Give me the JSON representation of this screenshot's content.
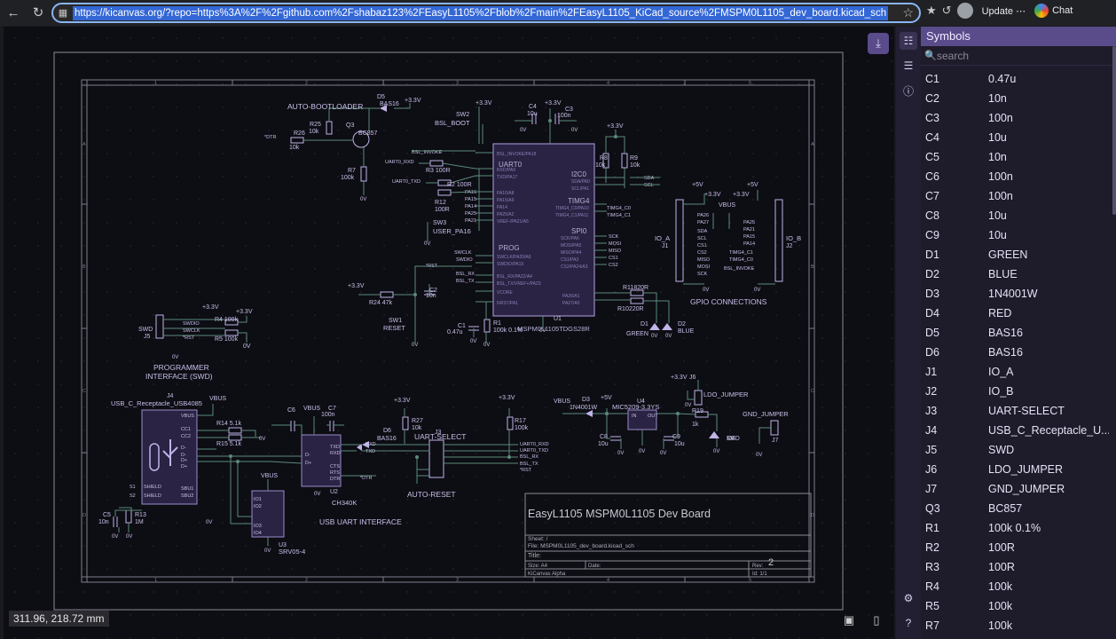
{
  "browser": {
    "url": "https://kicanvas.org/?repo=https%3A%2F%2Fgithub.com%2Fshabaz123%2FEasyL1105%2Fblob%2Fmain%2FEasyL1105_KiCad_source%2FMSPM0L1105_dev_board.kicad_sch",
    "update_label": "Update",
    "chat_label": "Chat"
  },
  "viewer": {
    "coordinates": "311.96, 218.72 mm"
  },
  "schematic": {
    "title": "EasyL1105 MSPM0L1105 Dev Board",
    "sheet_line": "Sheet: /",
    "file_line": "File: MSPM0L1105_dev_board.kicad_sch",
    "title_label": "Title:",
    "size_label": "Size: A4",
    "date_label": "Date:",
    "rev_label": "Rev:",
    "rev_value": "2",
    "tool_label": "KiCanvas Alpha",
    "id_label": "Id: 1/1",
    "labels": {
      "auto_bootloader": "AUTO-BOOTLOADER",
      "programmer": "PROGRAMMER",
      "interface_swd": "INTERFACE (SWD)",
      "usb_uart": "USB UART INTERFACE",
      "uart_select": "UART-SELECT",
      "auto_reset": "AUTO-RESET",
      "gpio_connections": "GPIO CONNECTIONS",
      "ldo_jumper": "LDO_JUMPER",
      "gnd_jumper": "GND_JUMPER",
      "usb_c": "USB_C_Receptacle_USB4085",
      "mcu": "MSPM0L1105TDGS28R",
      "ldo": "MIC5209-3.3YS",
      "ch340": "CH340K",
      "srv": "SRV05-4",
      "user_pa16": "USER_PA16",
      "reset": "RESET",
      "bsl_boot": "BSL_BOOT",
      "plus33": "+3.3V",
      "vbus": "VBUS",
      "plus5": "+5V",
      "uart0": "UART0",
      "i2c0": "I2C0",
      "timg4": "TIMG4",
      "spi0": "SPI0",
      "prog": "PROG",
      "io_a": "IO_A",
      "io_b": "IO_B"
    }
  },
  "panel": {
    "title": "Symbols",
    "search_placeholder": "search",
    "symbols": [
      {
        "ref": "C1",
        "value": "0.47u"
      },
      {
        "ref": "C2",
        "value": "10n"
      },
      {
        "ref": "C3",
        "value": "100n"
      },
      {
        "ref": "C4",
        "value": "10u"
      },
      {
        "ref": "C5",
        "value": "10n"
      },
      {
        "ref": "C6",
        "value": "100n"
      },
      {
        "ref": "C7",
        "value": "100n"
      },
      {
        "ref": "C8",
        "value": "10u"
      },
      {
        "ref": "C9",
        "value": "10u"
      },
      {
        "ref": "D1",
        "value": "GREEN"
      },
      {
        "ref": "D2",
        "value": "BLUE"
      },
      {
        "ref": "D3",
        "value": "1N4001W"
      },
      {
        "ref": "D4",
        "value": "RED"
      },
      {
        "ref": "D5",
        "value": "BAS16"
      },
      {
        "ref": "D6",
        "value": "BAS16"
      },
      {
        "ref": "J1",
        "value": "IO_A"
      },
      {
        "ref": "J2",
        "value": "IO_B"
      },
      {
        "ref": "J3",
        "value": "UART-SELECT"
      },
      {
        "ref": "J4",
        "value": "USB_C_Receptacle_U..."
      },
      {
        "ref": "J5",
        "value": "SWD"
      },
      {
        "ref": "J6",
        "value": "LDO_JUMPER"
      },
      {
        "ref": "J7",
        "value": "GND_JUMPER"
      },
      {
        "ref": "Q3",
        "value": "BC857"
      },
      {
        "ref": "R1",
        "value": "100k 0.1%"
      },
      {
        "ref": "R2",
        "value": "100R"
      },
      {
        "ref": "R3",
        "value": "100R"
      },
      {
        "ref": "R4",
        "value": "100k"
      },
      {
        "ref": "R5",
        "value": "100k"
      },
      {
        "ref": "R7",
        "value": "100k"
      }
    ]
  }
}
